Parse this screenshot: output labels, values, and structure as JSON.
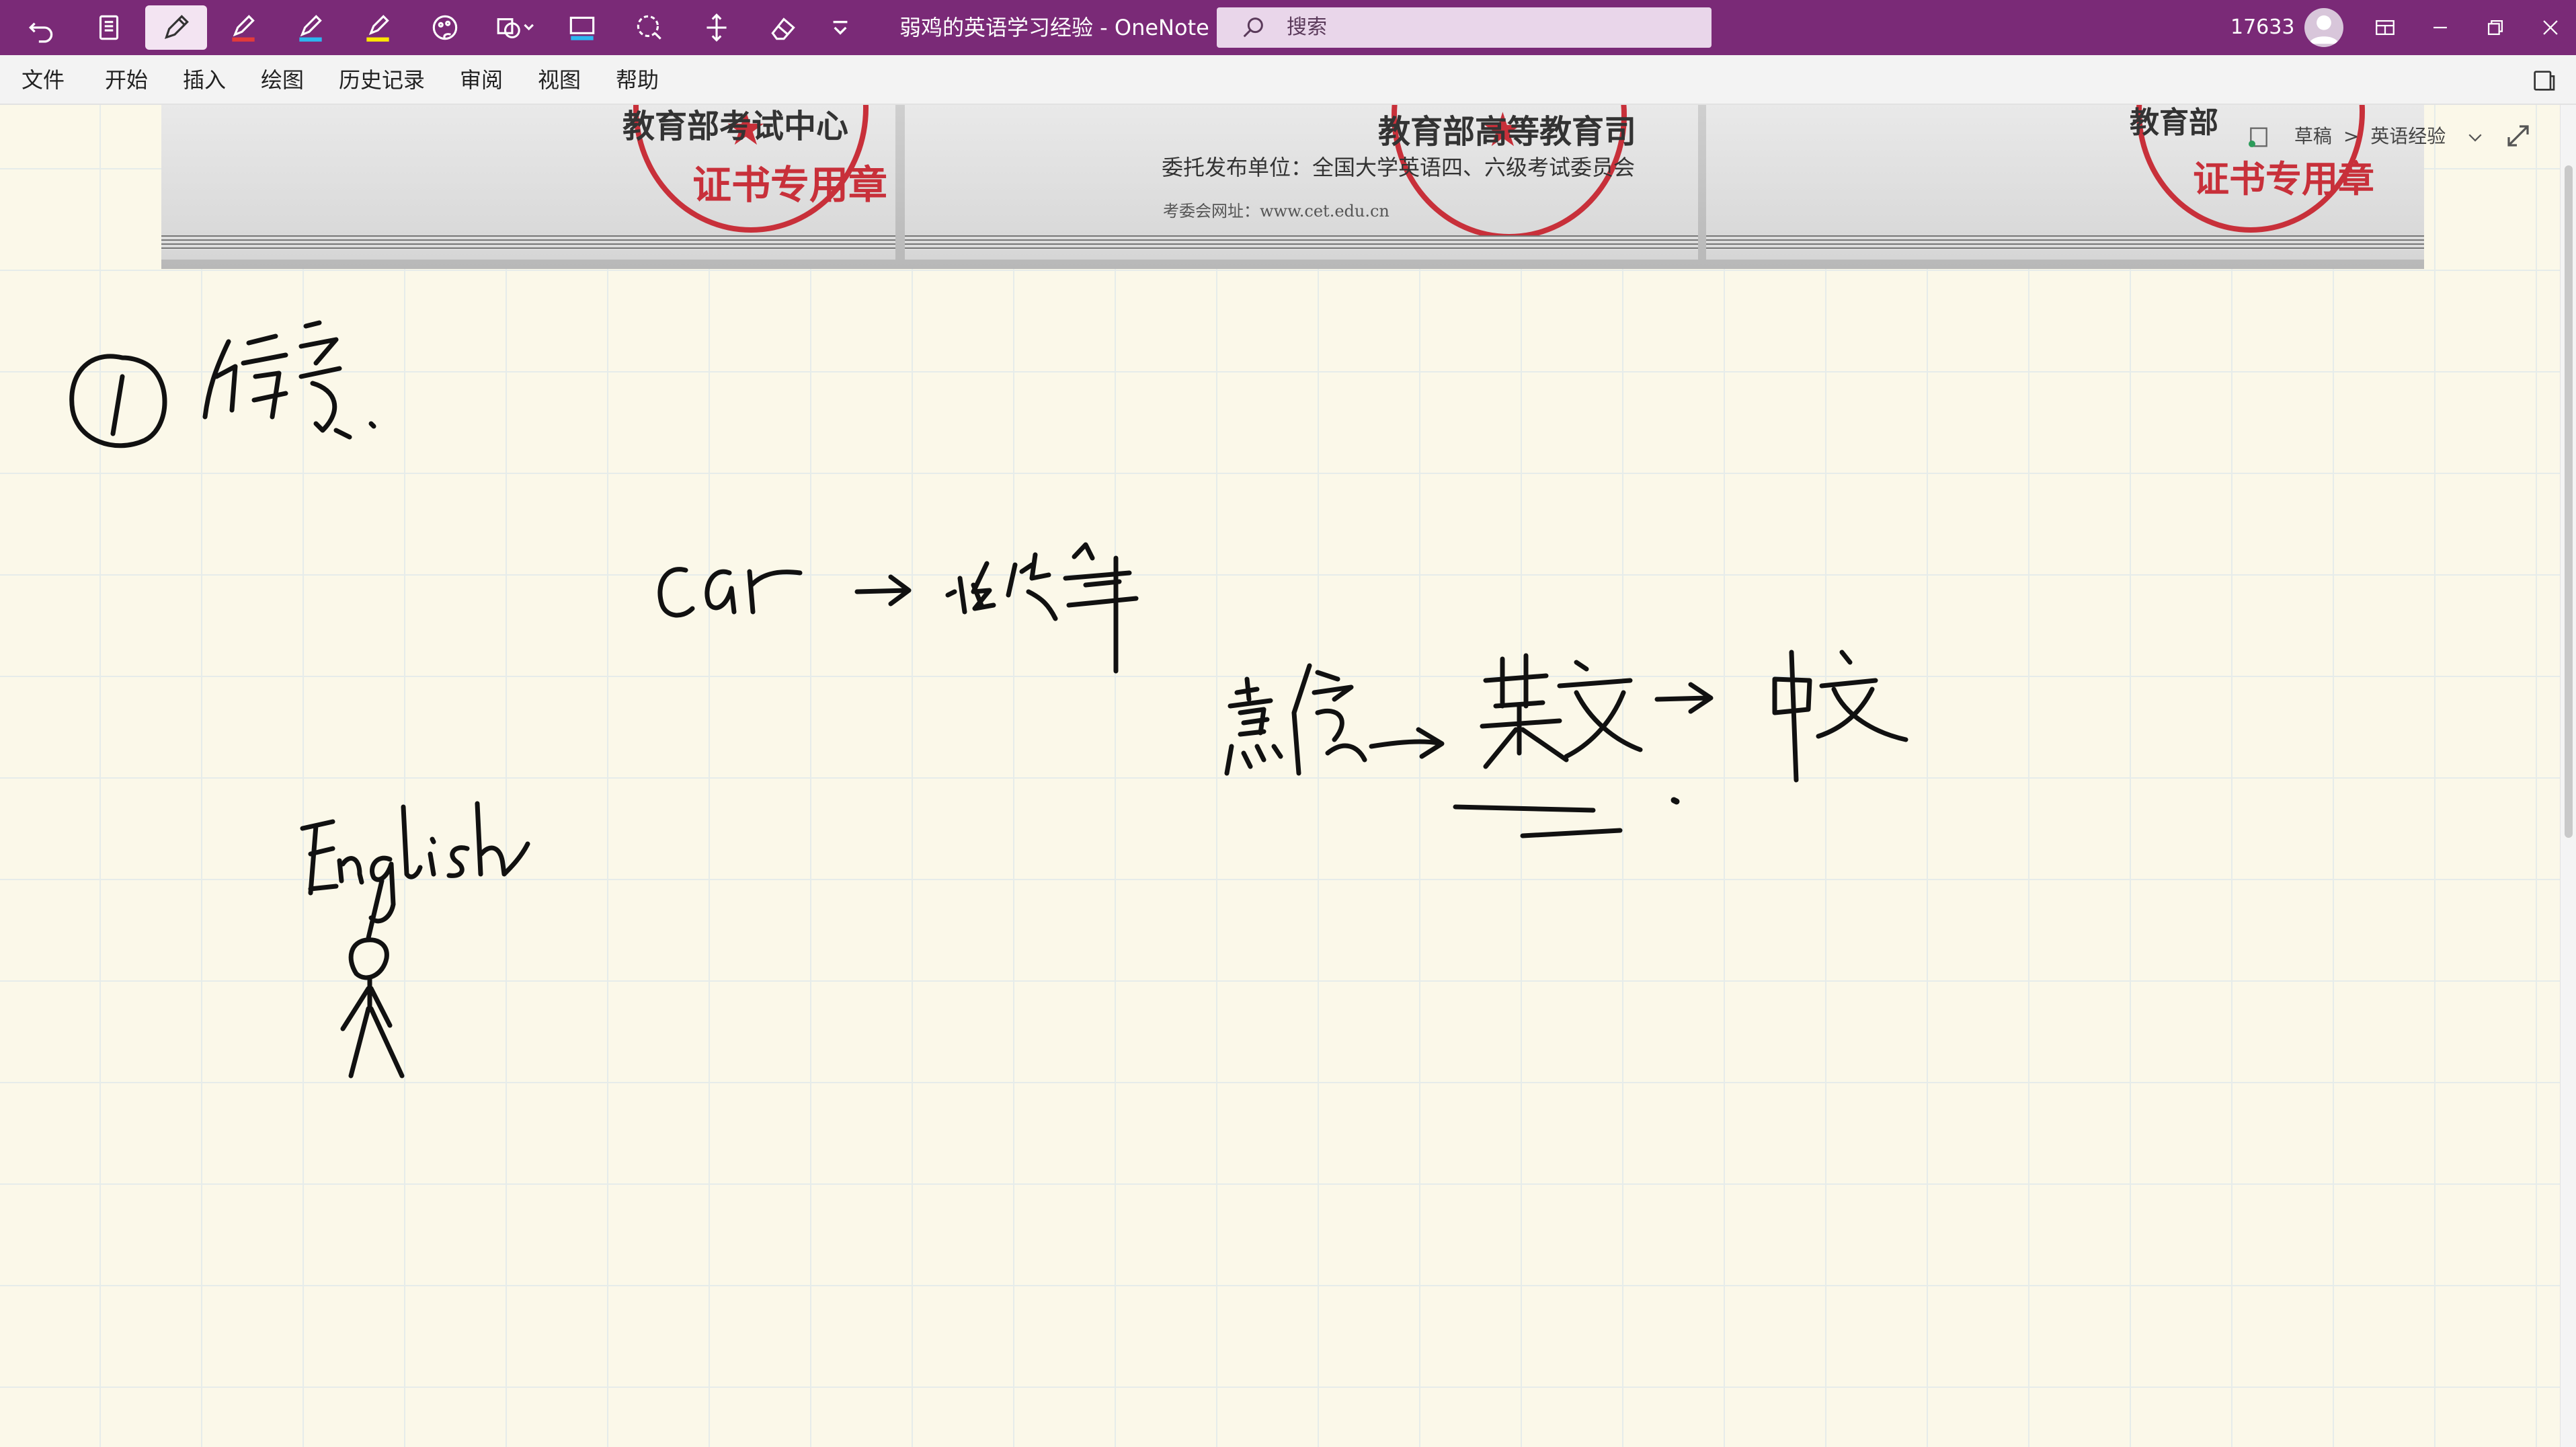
{
  "titlebar": {
    "title": "弱鸡的英语学习经验  -  OneNote",
    "search_placeholder": "搜索",
    "user_id": "17633",
    "tools": [
      "undo-icon",
      "full-page-view-icon",
      "pen-icon",
      "red-pen-icon",
      "blue-pen-icon",
      "highlighter-icon",
      "ink-to-text-icon",
      "shapes-icon",
      "color-icon",
      "lasso-icon",
      "add-space-icon",
      "eraser-icon",
      "more-icon"
    ]
  },
  "menu": {
    "items": [
      "文件",
      "开始",
      "插入",
      "绘图",
      "历史记录",
      "审阅",
      "视图",
      "帮助"
    ]
  },
  "breadcrumb": {
    "section": "草稿",
    "separator": ">",
    "page": "英语经验"
  },
  "certificate": {
    "left_header": "教育部考试中心",
    "left_stamp": "证书专用章",
    "middle_header": "教育部高等教育司",
    "middle_line1": "委托发布单位：全国大学英语四、六级考试委员会",
    "middle_line2": "考委会网址：www.cet.edu.cn",
    "right_header": "教育部",
    "right_stamp": "证书专用章"
  },
  "colors": {
    "titlebar": "#7a2a77",
    "canvas": "#fbf8e9",
    "grid": "#e6ecea",
    "ink": "#111111",
    "stamp_red": "#c8303a"
  }
}
